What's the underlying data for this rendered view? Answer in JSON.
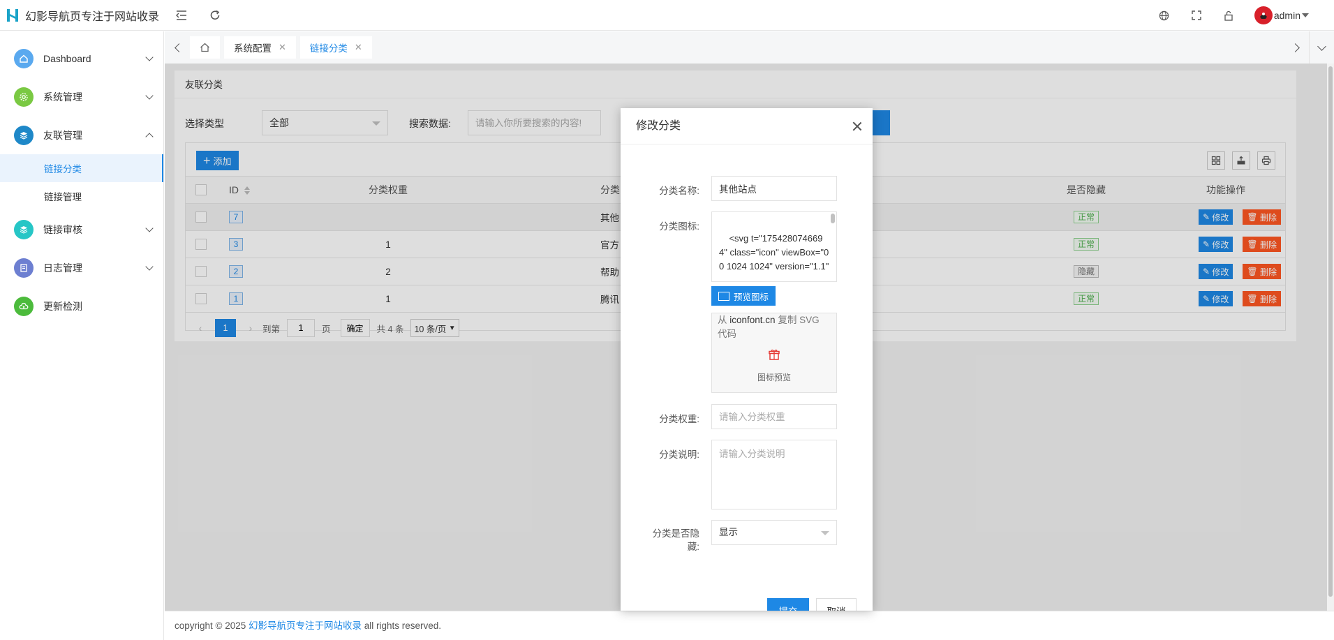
{
  "app": {
    "title": "幻影导航页专注于网站收录"
  },
  "header": {
    "user": "admin"
  },
  "sidebar": {
    "items": [
      {
        "label": "Dashboard",
        "color": "#5aa9ef"
      },
      {
        "label": "系统管理",
        "color": "#7ac943"
      },
      {
        "label": "友联管理",
        "color": "#1e88c8"
      },
      {
        "label": "链接审核",
        "color": "#26c6c6"
      },
      {
        "label": "日志管理",
        "color": "#6d7fd1"
      },
      {
        "label": "更新检测",
        "color": "#4cbb3c"
      }
    ],
    "sub": [
      "链接分类",
      "链接管理"
    ]
  },
  "tabs": [
    "系统配置",
    "链接分类"
  ],
  "page": {
    "title": "友联分类",
    "filter": {
      "type_label": "选择类型",
      "type_value": "全部",
      "search_label": "搜索数据:",
      "search_placeholder": "请输入你所要搜索的内容!"
    },
    "add_label": "添加"
  },
  "table": {
    "headers": {
      "id": "ID",
      "weight": "分类权重",
      "name": "分类",
      "hidden": "是否隐藏",
      "ops": "功能操作"
    },
    "rows": [
      {
        "id": "7",
        "weight": "",
        "name": "其他",
        "status": "正常"
      },
      {
        "id": "3",
        "weight": "1",
        "name": "官方",
        "status": "正常"
      },
      {
        "id": "2",
        "weight": "2",
        "name": "帮助",
        "status": "隐藏"
      },
      {
        "id": "1",
        "weight": "1",
        "name": "腾讯",
        "status": "正常"
      }
    ],
    "edit_label": "修改",
    "delete_label": "删除"
  },
  "pager": {
    "current": "1",
    "goto_label": "到第",
    "goto_value": "1",
    "page_unit": "页",
    "confirm": "确定",
    "total": "共 4 条",
    "per_page": "10 条/页"
  },
  "modal": {
    "title": "修改分类",
    "name_label": "分类名称:",
    "name_value": "其他站点",
    "icon_label": "分类图标:",
    "icon_value": "<svg t=\"1754280746694\" class=\"icon\" viewBox=\"0 0 1024 1024\" version=\"1.1\"",
    "preview_btn": "预览图标",
    "hint_prefix": "从 ",
    "hint_site": "iconfont.cn",
    "hint_suffix": " 复制 SVG 代码",
    "preview_label": "图标预览",
    "weight_label": "分类权重:",
    "weight_placeholder": "请输入分类权重",
    "desc_label": "分类说明:",
    "desc_placeholder": "请输入分类说明",
    "hide_label_1": "分类是否隐",
    "hide_label_2": "藏:",
    "hide_value": "显示",
    "submit": "提交",
    "cancel": "取消"
  },
  "footer": {
    "prefix": "copyright © 2025 ",
    "link": "幻影导航页专注于网站收录",
    "suffix": " all rights reserved."
  }
}
